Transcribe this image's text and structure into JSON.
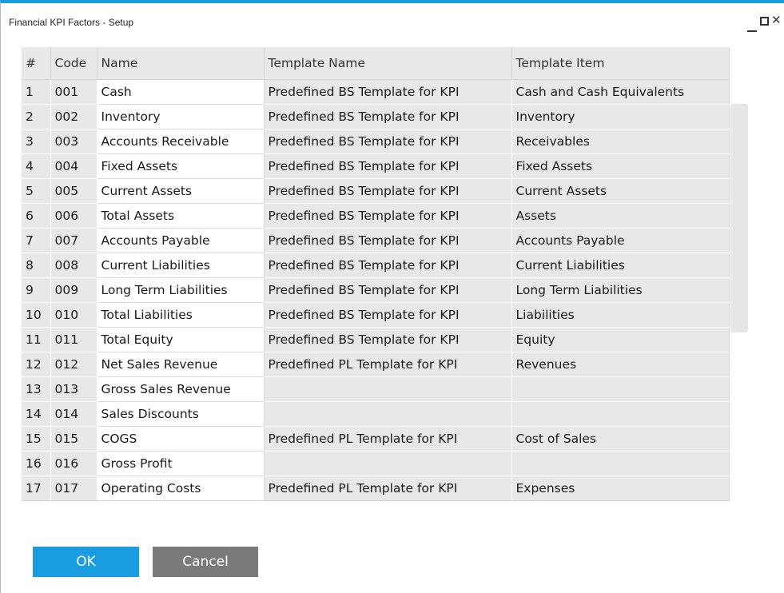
{
  "window": {
    "title": "Financial KPI Factors - Setup"
  },
  "table": {
    "columns": [
      "#",
      "Code",
      "Name",
      "Template Name",
      "Template Item"
    ],
    "rows": [
      [
        "1",
        "001",
        "Cash",
        "Predefined BS Template for KPI",
        "Cash and Cash Equivalents"
      ],
      [
        "2",
        "002",
        "Inventory",
        "Predefined BS Template for KPI",
        "Inventory"
      ],
      [
        "3",
        "003",
        "Accounts Receivable",
        "Predefined BS Template for KPI",
        "Receivables"
      ],
      [
        "4",
        "004",
        "Fixed Assets",
        "Predefined BS Template for KPI",
        "Fixed Assets"
      ],
      [
        "5",
        "005",
        "Current Assets",
        "Predefined BS Template for KPI",
        "Current Assets"
      ],
      [
        "6",
        "006",
        "Total Assets",
        "Predefined BS Template for KPI",
        "Assets"
      ],
      [
        "7",
        "007",
        "Accounts Payable",
        "Predefined BS Template for KPI",
        "Accounts Payable"
      ],
      [
        "8",
        "008",
        "Current Liabilities",
        "Predefined BS Template for KPI",
        "Current Liabilities"
      ],
      [
        "9",
        "009",
        "Long Term Liabilities",
        "Predefined BS Template for KPI",
        "Long Term Liabilities"
      ],
      [
        "10",
        "010",
        "Total Liabilities",
        "Predefined BS Template for KPI",
        "Liabilities"
      ],
      [
        "11",
        "011",
        "Total Equity",
        "Predefined BS Template for KPI",
        "Equity"
      ],
      [
        "12",
        "012",
        "Net Sales Revenue",
        "Predefined PL Template for KPI",
        "Revenues"
      ],
      [
        "13",
        "013",
        "Gross Sales Revenue",
        "",
        ""
      ],
      [
        "14",
        "014",
        "Sales Discounts",
        "",
        ""
      ],
      [
        "15",
        "015",
        "COGS",
        "Predefined PL Template for KPI",
        "Cost of Sales"
      ],
      [
        "16",
        "016",
        "Gross Profit",
        "",
        ""
      ],
      [
        "17",
        "017",
        "Operating Costs",
        "Predefined PL Template for KPI",
        "Expenses"
      ]
    ]
  },
  "buttons": {
    "ok": "OK",
    "cancel": "Cancel"
  },
  "colors": {
    "accent": "#1a9ce0",
    "cancel": "#7a7a7a",
    "readonly_cell": "#e8e8e8"
  }
}
